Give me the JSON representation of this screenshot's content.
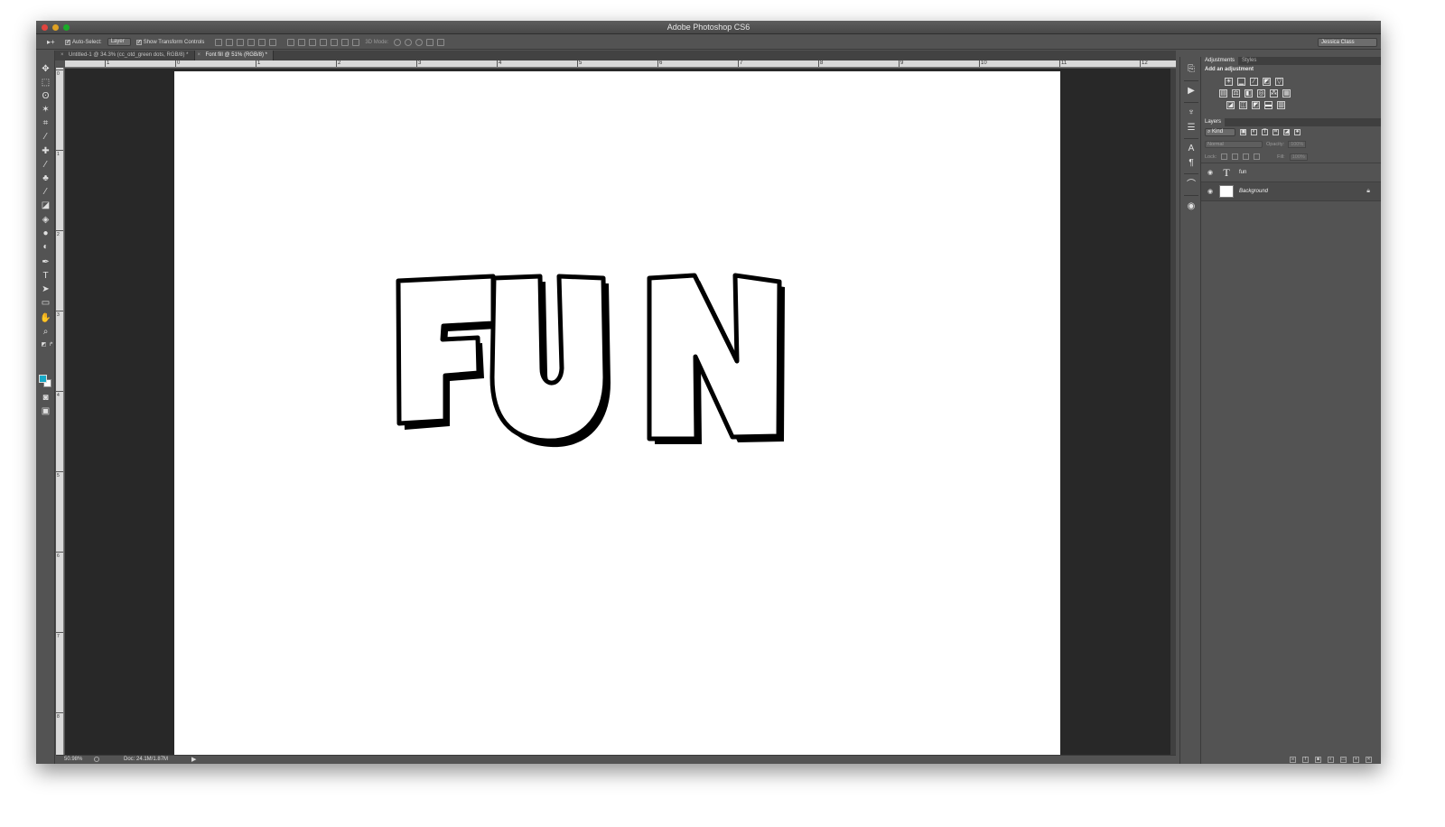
{
  "app": {
    "title": "Adobe Photoshop CS6"
  },
  "options_bar": {
    "tool_arrow": "▸+",
    "auto_select_label": "Auto-Select:",
    "auto_select_value": "Layer",
    "show_transform_label": "Show Transform Controls",
    "mode_3d_label": "3D Mode:",
    "workspace": "Jessica Class"
  },
  "tabs": [
    {
      "label": "Untitled-1 @ 34.3% (cc_otd_green dots, RGB/8) *"
    },
    {
      "label": "Font fill @ 51% (RGB/8) *",
      "active": true
    }
  ],
  "rulers": {
    "top_labels": [
      "1",
      "0",
      "1",
      "2",
      "3",
      "4",
      "5",
      "6",
      "7",
      "8",
      "9",
      "10",
      "11",
      "12"
    ],
    "left_labels": [
      "0",
      "1",
      "2",
      "3",
      "4",
      "5",
      "6",
      "7",
      "8"
    ]
  },
  "canvas": {
    "text": "FUN",
    "artboard_color": "#ffffff",
    "pasteboard_color": "#282828"
  },
  "colors": {
    "foreground": "#18a9c6",
    "background": "#ffffff"
  },
  "status": {
    "zoom": "50.98%",
    "doc": "Doc: 24.1M/1.87M"
  },
  "panels": {
    "adjustments_tab": "Adjustments",
    "styles_tab": "Styles",
    "add_adjustment": "Add an adjustment",
    "layers_tab": "Layers",
    "kind": "Kind",
    "blend_mode": "Normal",
    "opacity_label": "Opacity:",
    "opacity_value": "100%",
    "lock_label": "Lock:",
    "fill_label": "Fill:",
    "fill_value": "100%",
    "layers": [
      {
        "name": "fun",
        "type": "text"
      },
      {
        "name": "Background",
        "type": "background",
        "locked": true
      }
    ]
  }
}
